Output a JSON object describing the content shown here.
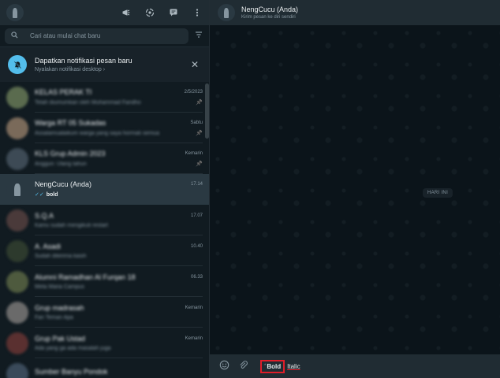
{
  "left_header": {
    "icons": [
      "communities-icon",
      "status-icon",
      "new-chat-icon",
      "menu-icon"
    ]
  },
  "search": {
    "placeholder": "Cari atau mulai chat baru"
  },
  "notification": {
    "title": "Dapatkan notifikasi pesan baru",
    "subtitle": "Nyalakan notifikasi desktop ›"
  },
  "chats": [
    {
      "name": "KELAS PERAK TI",
      "time": "2/5/2023",
      "preview": "Telah diumumkan oleh Muhammad Faridho",
      "pinned": true,
      "blurred": true,
      "avatar_color": "#5a6b4e"
    },
    {
      "name": "Warga RT 05 Sukadas",
      "time": "Sabtu",
      "preview": "Assalamualaikum warga yang saya hormati semua",
      "pinned": true,
      "blurred": true,
      "avatar_color": "#7a6a5a"
    },
    {
      "name": "KLS Grup Admin 2023",
      "time": "Kemarin",
      "preview": "Anggun: Ulang tahun",
      "pinned": true,
      "blurred": true,
      "avatar_color": "#3d4a55"
    },
    {
      "name": "NengCucu (Anda)",
      "time": "17.14",
      "preview": "bold",
      "pinned": false,
      "blurred": false,
      "active": true,
      "avatar_color": "#2a3942"
    },
    {
      "name": "S.Q.A",
      "time": "17.07",
      "preview": "Kamu sudah mengikuti restart",
      "pinned": false,
      "blurred": true,
      "avatar_color": "#4a3a3a"
    },
    {
      "name": "A. Asadi",
      "time": "10.40",
      "preview": "Sudah diterima kasih",
      "pinned": false,
      "blurred": true,
      "avatar_color": "#2d3a2d"
    },
    {
      "name": "Alumni Ramadhan Al Furqan 18",
      "time": "06.33",
      "preview": "Meta Maria Campus",
      "pinned": false,
      "blurred": true,
      "avatar_color": "#4e5a3e"
    },
    {
      "name": "Grup madrasah",
      "time": "Kemarin",
      "preview": "Fan Teman Apa",
      "pinned": false,
      "blurred": true,
      "avatar_color": "#6a6a6a"
    },
    {
      "name": "Grup Pak Ustad",
      "time": "Kemarin",
      "preview": "Ada yang ga ada masalah juga",
      "pinned": false,
      "blurred": true,
      "avatar_color": "#5a3030"
    },
    {
      "name": "Sumber Banyu Pondok",
      "time": "",
      "preview": "",
      "pinned": false,
      "blurred": true,
      "avatar_color": "#3a4a5a"
    }
  ],
  "conversation": {
    "name": "NengCucu (Anda)",
    "subtitle": "Kirim pesan ke diri sendiri",
    "date_chip": "HARI INI"
  },
  "compose": {
    "star": "*",
    "bold_text": "Bold",
    "italic_text": "Italic"
  },
  "colors": {
    "accent_blue": "#53bdeb",
    "highlight_red": "#e01e2a",
    "panel": "#202c33",
    "background": "#111b21"
  }
}
